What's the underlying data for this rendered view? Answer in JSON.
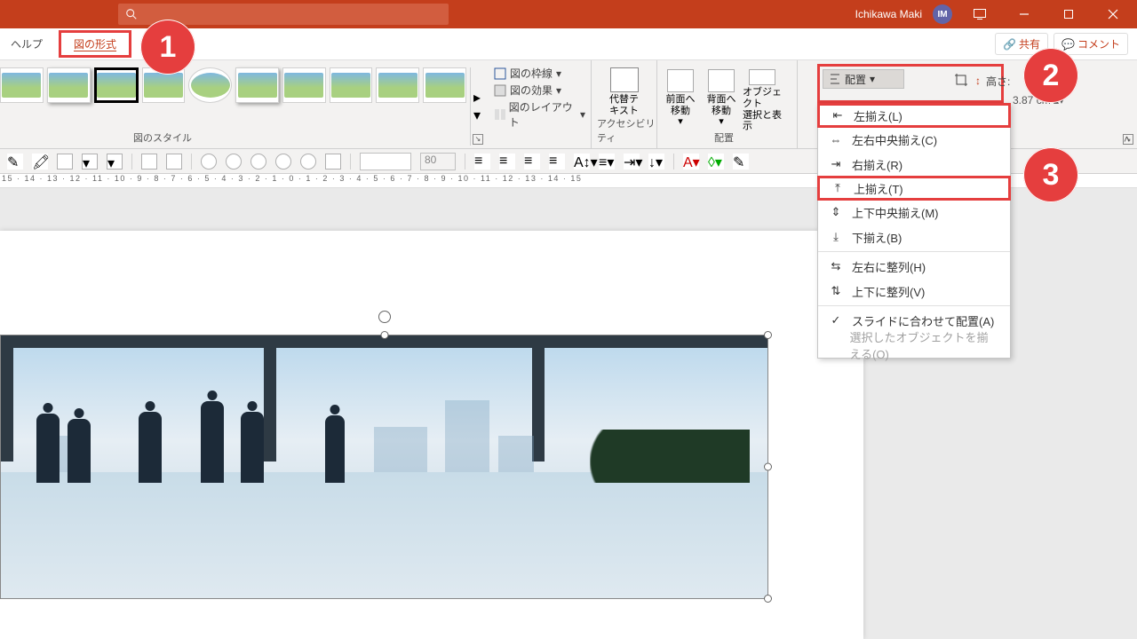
{
  "titleBar": {
    "userName": "Ichikawa Maki",
    "avatarInitials": "IM"
  },
  "tabs": {
    "help": "ヘルプ",
    "pictureFormat": "図の形式",
    "shareLabel": "共有",
    "commentLabel": "コメント"
  },
  "ribbon": {
    "stylesGroupLabel": "図のスタイル",
    "outline": "図の枠線",
    "effects": "図の効果",
    "layout": "図のレイアウト",
    "accLabel": "アクセシビリティ",
    "altText1": "代替テ",
    "altText2": "キスト",
    "arrangeGroupLabel": "配置",
    "bringForward1": "前面へ",
    "bringForward2": "移動",
    "sendBackward1": "背面へ",
    "sendBackward2": "移動",
    "selection1": "オブジェクト",
    "selection2": "選択と表示",
    "arrangeBtn": "配置",
    "heightLabel": "高さ:",
    "heightValue": "3.87 cm"
  },
  "menu": {
    "alignLeft": "左揃え(L)",
    "alignCenterH": "左右中央揃え(C)",
    "alignRight": "右揃え(R)",
    "alignTop": "上揃え(T)",
    "alignMiddle": "上下中央揃え(M)",
    "alignBottom": "下揃え(B)",
    "distributeH": "左右に整列(H)",
    "distributeV": "上下に整列(V)",
    "alignToSlide": "スライドに合わせて配置(A)",
    "alignSelected": "選択したオブジェクトを揃える(O)"
  },
  "toolbar2": {
    "fontSize": "80"
  },
  "ruler": "15 · 14 · 13 · 12 · 11 · 10 · 9 · 8 · 7 · 6 · 5 · 4 · 3 · 2 · 1 · 0 · 1 · 2 · 3 · 4 · 5 · 6 · 7 · 8 · 9 · 10 · 11 · 12 · 13 · 14 · 15",
  "callouts": {
    "one": "1",
    "two": "2",
    "three": "3"
  }
}
